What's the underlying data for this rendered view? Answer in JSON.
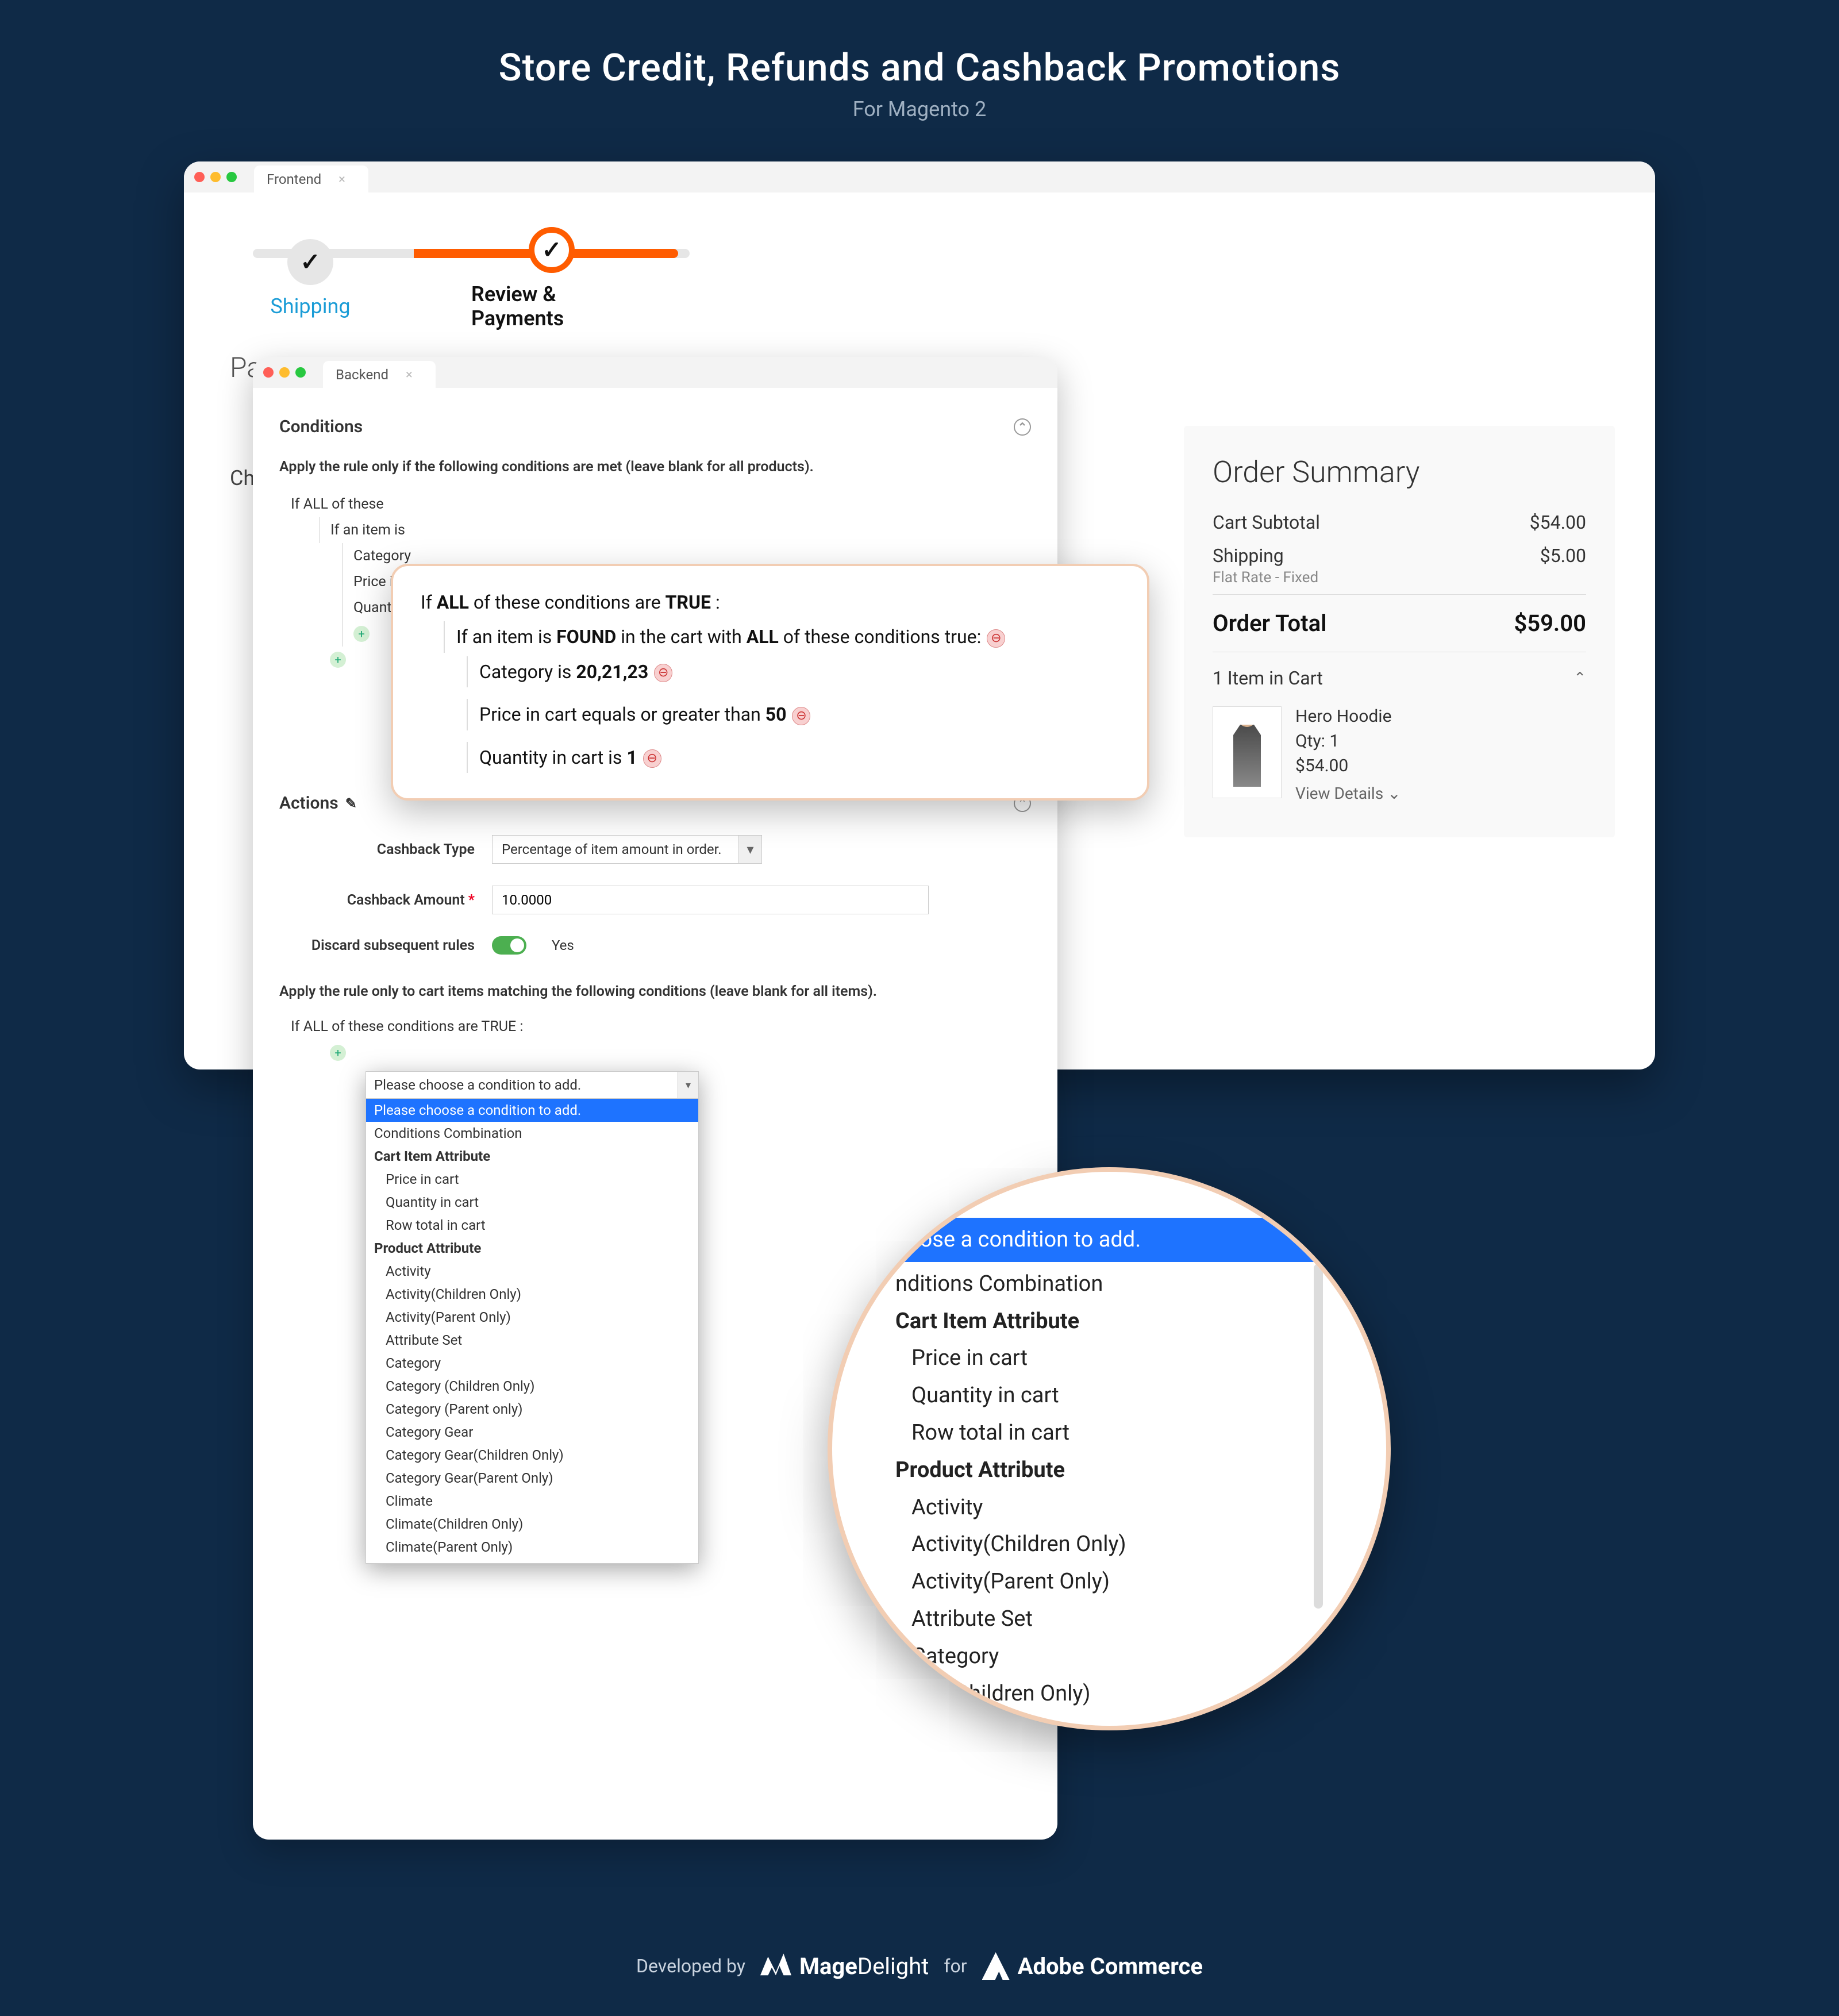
{
  "header": {
    "title": "Store Credit, Refunds and Cashback Promotions",
    "subtitle": "For Magento 2"
  },
  "tabs": {
    "frontend": "Frontend",
    "backend": "Backend"
  },
  "steps": {
    "shipping": "Shipping",
    "review": "Review & Payments"
  },
  "frontend_stub": {
    "pa": "Pa",
    "ch": "Ch"
  },
  "order_summary": {
    "title": "Order Summary",
    "subtotal_label": "Cart Subtotal",
    "subtotal": "$54.00",
    "shipping_label": "Shipping",
    "shipping": "$5.00",
    "shipping_method": "Flat Rate - Fixed",
    "total_label": "Order Total",
    "total": "$59.00",
    "cart_header": "1 Item in Cart",
    "item": {
      "name": "Hero Hoodie",
      "qty": "Qty: 1",
      "price": "$54.00",
      "view": "View Details ⌄"
    }
  },
  "backend": {
    "conditions_title": "Conditions",
    "cond_instr": "Apply the rule only if the following conditions are met (leave blank for all products).",
    "tree": {
      "l1": "If ALL  of these ",
      "l2": "If an item is ",
      "l3a": "Category ",
      "l3b": "Price in ca",
      "l3c": "Quantity i"
    },
    "actions_title": "Actions",
    "form": {
      "cashback_type_label": "Cashback Type",
      "cashback_type_value": "Percentage of item amount in order.",
      "cashback_amount_label": "Cashback Amount",
      "cashback_amount_value": "10.0000",
      "discard_label": "Discard subsequent rules",
      "discard_value": "Yes"
    },
    "act_instr": "Apply the rule only to cart items matching the following conditions (leave blank for all items).",
    "act_tree": "If ALL  of these conditions are TRUE :"
  },
  "dropdown": {
    "placeholder": "Please choose a condition to add.",
    "items": [
      {
        "label": "Please choose a condition to add.",
        "selected": true
      },
      {
        "label": "Conditions Combination"
      },
      {
        "label": "Cart Item Attribute",
        "group": true
      },
      {
        "label": "Price in cart",
        "indent": true
      },
      {
        "label": "Quantity in cart",
        "indent": true
      },
      {
        "label": "Row total in cart",
        "indent": true
      },
      {
        "label": "Product Attribute",
        "group": true
      },
      {
        "label": "Activity",
        "indent": true
      },
      {
        "label": "Activity(Children Only)",
        "indent": true
      },
      {
        "label": "Activity(Parent Only)",
        "indent": true
      },
      {
        "label": "Attribute Set",
        "indent": true
      },
      {
        "label": "Category",
        "indent": true
      },
      {
        "label": "Category (Children Only)",
        "indent": true
      },
      {
        "label": "Category (Parent only)",
        "indent": true
      },
      {
        "label": "Category Gear",
        "indent": true
      },
      {
        "label": "Category Gear(Children Only)",
        "indent": true
      },
      {
        "label": "Category Gear(Parent Only)",
        "indent": true
      },
      {
        "label": "Climate",
        "indent": true
      },
      {
        "label": "Climate(Children Only)",
        "indent": true
      },
      {
        "label": "Climate(Parent Only)",
        "indent": true
      }
    ]
  },
  "callout": {
    "l1_pre": "If ",
    "l1_b1": "ALL",
    "l1_mid": "  of these conditions are ",
    "l1_b2": "TRUE",
    "l1_post": " :",
    "l2_pre": "If an item is ",
    "l2_b1": "FOUND",
    "l2_mid": "  in the cart with ",
    "l2_b2": "ALL",
    "l2_post": "  of these conditions true:",
    "l3a_pre": "Category  ",
    "l3a_op": "is",
    "l3a_val": "  20,21,23",
    "l3b_pre": "Price in cart  ",
    "l3b_op": "equals or greater than",
    "l3b_val": "  50",
    "l3c_pre": "Quantity in cart  ",
    "l3c_op": "is",
    "l3c_val": "  1"
  },
  "magnifier": {
    "sel": "hoose a condition to add.",
    "items": [
      {
        "label": "nditions Combination"
      },
      {
        "label": "Cart Item Attribute",
        "group": true
      },
      {
        "label": "Price in cart",
        "indent": true
      },
      {
        "label": "Quantity in cart",
        "indent": true
      },
      {
        "label": "Row total in cart",
        "indent": true
      },
      {
        "label": "Product Attribute",
        "group": true
      },
      {
        "label": "Activity",
        "indent": true
      },
      {
        "label": "Activity(Children Only)",
        "indent": true
      },
      {
        "label": "Activity(Parent Only)",
        "indent": true
      },
      {
        "label": "Attribute Set",
        "indent": true
      },
      {
        "label": "Category",
        "indent": true
      },
      {
        "label": "ory (Children Only)",
        "indent": true
      }
    ],
    "overflow": "t l )"
  },
  "footer": {
    "dev_by": "Developed by",
    "md": "Mage",
    "md2": "Delight",
    "for": "for",
    "adobe": "Adobe Commerce"
  }
}
